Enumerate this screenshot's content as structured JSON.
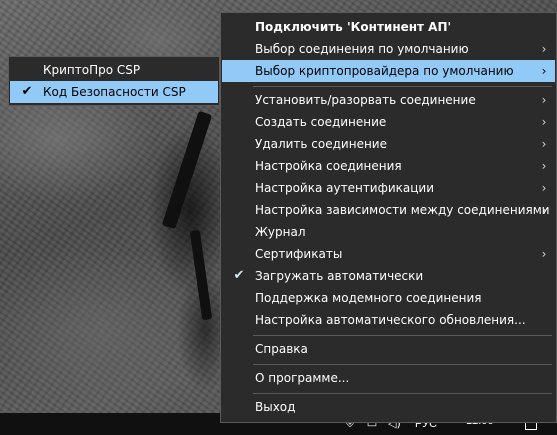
{
  "main_menu": {
    "items": [
      {
        "label": "Подключить 'Континент АП'",
        "bold": true,
        "submenu": false,
        "checked": false
      },
      {
        "label": "Выбор соединения по умолчанию",
        "submenu": true,
        "checked": false
      },
      {
        "label": "Выбор криптопровайдера по умолчанию",
        "submenu": true,
        "checked": false,
        "highlighted": true
      },
      {
        "label": "Установить/разорвать соединение",
        "submenu": true,
        "checked": false
      },
      {
        "label": "Создать соединение",
        "submenu": true,
        "checked": false
      },
      {
        "label": "Удалить соединение",
        "submenu": true,
        "checked": false
      },
      {
        "label": "Настройка соединения",
        "submenu": true,
        "checked": false
      },
      {
        "label": "Настройка аутентификации",
        "submenu": true,
        "checked": false
      },
      {
        "label": "Настройка зависимости между соединениями",
        "submenu": true,
        "checked": false
      },
      {
        "label": "Журнал",
        "submenu": false,
        "checked": false
      },
      {
        "label": "Сертификаты",
        "submenu": true,
        "checked": false
      },
      {
        "label": "Загружать автоматически",
        "submenu": false,
        "checked": true
      },
      {
        "label": "Поддержка модемного соединения",
        "submenu": false,
        "checked": false
      },
      {
        "label": "Настройка автоматического обновления...",
        "submenu": false,
        "checked": false
      },
      {
        "label": "Справка",
        "submenu": false,
        "checked": false
      },
      {
        "label": "О программе...",
        "submenu": false,
        "checked": false
      },
      {
        "label": "Выход",
        "submenu": false,
        "checked": false
      }
    ]
  },
  "sub_menu": {
    "items": [
      {
        "label": "КриптоПро CSP",
        "checked": false
      },
      {
        "label": "Код Безопасности CSP",
        "checked": true,
        "highlighted": true
      }
    ]
  },
  "taskbar": {
    "language": "РУС",
    "clock": "12:06",
    "icons": [
      "chevron-up-icon",
      "antivirus-shield-icon",
      "network-icon",
      "volume-icon",
      "notifications-icon"
    ]
  },
  "colors": {
    "menu_bg": "#2b2b2b",
    "highlight": "#91c9f7",
    "taskbar_bg": "#101010"
  }
}
